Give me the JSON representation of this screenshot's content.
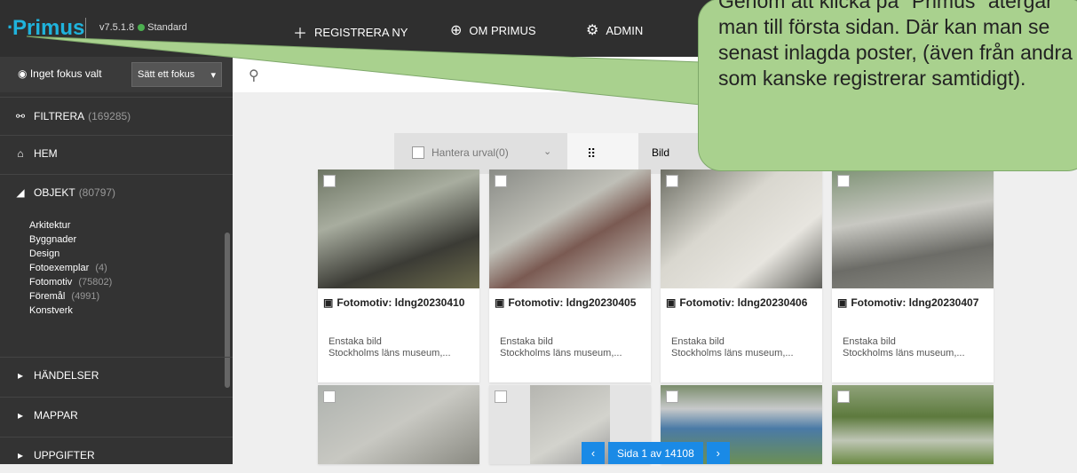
{
  "topbar": {
    "logo": "Primus",
    "version": "v7.5.1.8",
    "status": "Standard",
    "nav": [
      {
        "icon": "plus-icon",
        "label": "REGISTRERA NY"
      },
      {
        "icon": "globe-icon",
        "label": "OM PRIMUS"
      },
      {
        "icon": "gear-icon",
        "label": "ADMIN"
      }
    ]
  },
  "sidebar": {
    "focus_label": "Inget fokus valt",
    "focus_button": "Sätt ett fokus",
    "filter": {
      "label": "FILTRERA",
      "count": "(169285)"
    },
    "home": "HEM",
    "objekt": {
      "label": "OBJEKT",
      "count": "(80797)"
    },
    "sub_items": [
      {
        "label": "Arkitektur",
        "count": ""
      },
      {
        "label": "Byggnader",
        "count": ""
      },
      {
        "label": "Design",
        "count": ""
      },
      {
        "label": "Fotoexemplar",
        "count": "(4)"
      },
      {
        "label": "Fotomotiv",
        "count": "(75802)"
      },
      {
        "label": "Föremål",
        "count": "(4991)"
      },
      {
        "label": "Konstverk",
        "count": ""
      }
    ],
    "sections": [
      "HÄNDELSER",
      "MAPPAR",
      "UPPGIFTER"
    ]
  },
  "toolbar": {
    "select_label": "Hantera urval(0)",
    "view_label": "Bild"
  },
  "cards": [
    {
      "title": "Fotomotiv: ldng20230410",
      "line1": "Enstaka bild",
      "line2": "Stockholms läns museum,..."
    },
    {
      "title": "Fotomotiv: ldng20230405",
      "line1": "Enstaka bild",
      "line2": "Stockholms läns museum,..."
    },
    {
      "title": "Fotomotiv: ldng20230406",
      "line1": "Enstaka bild",
      "line2": "Stockholms läns museum,..."
    },
    {
      "title": "Fotomotiv: ldng20230407",
      "line1": "Enstaka bild",
      "line2": "Stockholms läns museum,..."
    }
  ],
  "pager": {
    "label": "Sida 1 av 14108"
  },
  "callout": {
    "lines": [
      "Genom att klicka på \"Primus\" återgår",
      "man till första sidan. Där kan man se",
      "senast inlagda poster, (även från andra",
      "som kanske registrerar samtidigt)."
    ]
  },
  "colors": {
    "accent": "#1fb3dc",
    "pager": "#1a8ae6",
    "callout": "#a9d18e",
    "status": "#4caf50"
  }
}
